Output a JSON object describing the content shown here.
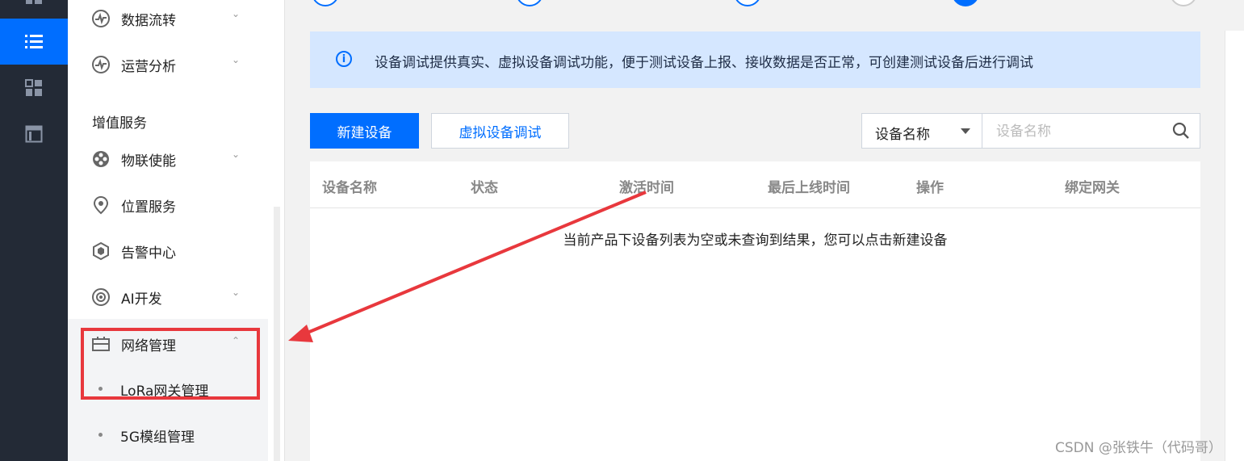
{
  "colors": {
    "rail_bg": "#232a36",
    "accent": "#006eff",
    "info_bg": "#d5e7ff",
    "annotation_red": "#e8383d"
  },
  "rail": {
    "items": [
      {
        "icon": "dashboard-icon"
      },
      {
        "icon": "list-icon",
        "active": true
      },
      {
        "icon": "grid-icon"
      },
      {
        "icon": "panel-icon"
      }
    ]
  },
  "sidebar": {
    "items": [
      {
        "label": "数据流转",
        "icon": "pulse-icon",
        "expandable": true
      },
      {
        "label": "运营分析",
        "icon": "pulse-icon",
        "expandable": true
      }
    ],
    "section_title": "增值服务",
    "services": [
      {
        "label": "物联使能",
        "icon": "film-reel-icon",
        "expandable": true
      },
      {
        "label": "位置服务",
        "icon": "location-pin-icon",
        "expandable": false
      },
      {
        "label": "告警中心",
        "icon": "alarm-hexagon-icon",
        "expandable": false
      },
      {
        "label": "AI开发",
        "icon": "camera-eye-icon",
        "expandable": true
      }
    ],
    "network": {
      "label": "网络管理",
      "icon": "network-icon",
      "expanded": true,
      "children": [
        "LoRa网关管理",
        "5G模组管理"
      ]
    }
  },
  "main": {
    "info_banner": "设备调试提供真实、虚拟设备调试功能，便于测试设备上报、接收数据是否正常，可创建测试设备后进行调试",
    "toolbar": {
      "new_device_button": "新建设备",
      "virtual_debug_button": "虚拟设备调试",
      "filter_select_value": "设备名称",
      "search_placeholder": "设备名称"
    },
    "table": {
      "columns": [
        "设备名称",
        "状态",
        "激活时间",
        "最后上线时间",
        "操作",
        "绑定网关"
      ],
      "empty_text": "当前产品下设备列表为空或未查询到结果，您可以点击新建设备"
    }
  },
  "watermark": "CSDN @张铁牛（代码哥）"
}
